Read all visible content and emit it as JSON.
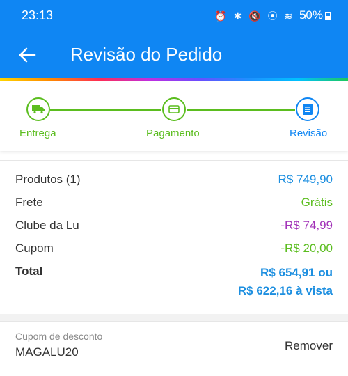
{
  "status_bar": {
    "time": "23:13",
    "icons": "⏰ ✱ 🔇 ⦿ ≋ .ıl",
    "battery": "50%"
  },
  "header": {
    "title": "Revisão do Pedido",
    "back_icon": "arrow-left-icon",
    "background": "#0f86f3"
  },
  "stepper": {
    "steps": [
      {
        "label": "Entrega",
        "icon": "truck-icon",
        "state": "done"
      },
      {
        "label": "Pagamento",
        "icon": "card-icon",
        "state": "done"
      },
      {
        "label": "Revisão",
        "icon": "list-icon",
        "state": "active"
      }
    ],
    "done_color": "#5bbd1f",
    "active_color": "#0f86f3"
  },
  "summary": {
    "rows": [
      {
        "label": "Produtos (1)",
        "value": "R$ 749,90"
      },
      {
        "label": "Frete",
        "value": "Grátis"
      },
      {
        "label": "Clube da Lu",
        "value": "-R$ 74,99"
      },
      {
        "label": "Cupom",
        "value": "-R$ 20,00"
      }
    ],
    "total_label": "Total",
    "total_installments": "R$ 654,91 ou",
    "total_cash": "R$ 622,16 à vista"
  },
  "coupon": {
    "label": "Cupom de desconto",
    "code": "MAGALU20",
    "remove_label": "Remover"
  }
}
